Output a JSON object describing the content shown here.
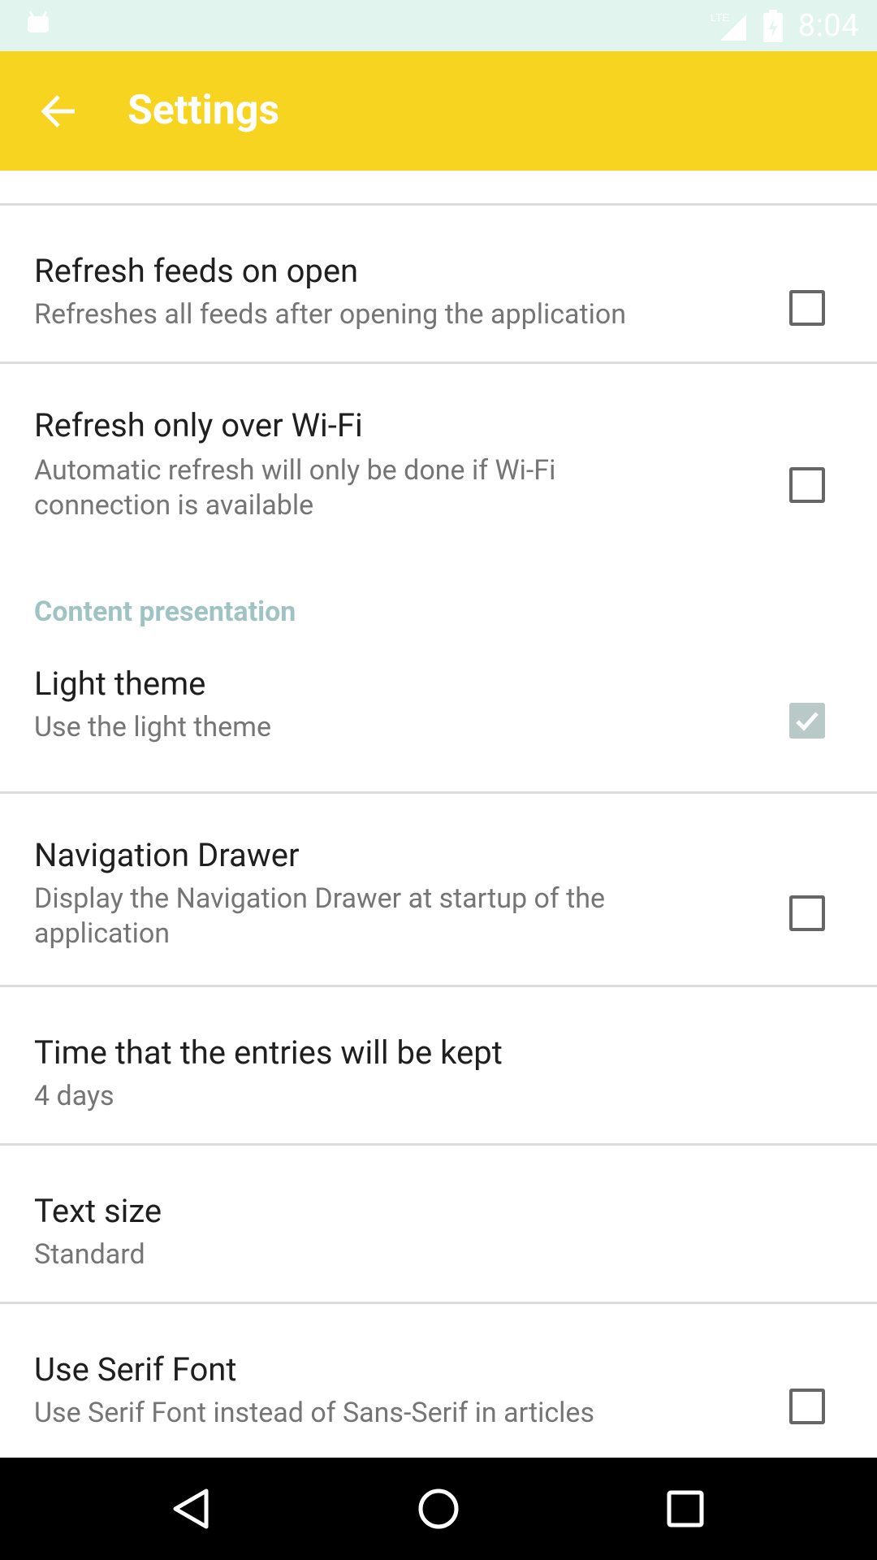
{
  "status_bar": {
    "time": "8:04",
    "network_label": "LTE",
    "icons": [
      "android-icon",
      "signal-icon",
      "battery-icon"
    ]
  },
  "app_bar": {
    "title": "Settings",
    "back_icon": "arrow-left-icon",
    "color": "#f6d420"
  },
  "preferences": [
    {
      "id": "refresh-on-open",
      "title": "Refresh feeds on open",
      "summary": "Refreshes all feeds after opening the application",
      "checkbox": true,
      "checked": false
    },
    {
      "id": "refresh-wifi",
      "title": "Refresh only over Wi-Fi",
      "summary": "Automatic refresh will only be done if Wi-Fi connection is available",
      "checkbox": true,
      "checked": false
    }
  ],
  "category": {
    "title": "Content presentation",
    "color": "#9fc3c3"
  },
  "presentation_preferences": [
    {
      "id": "light-theme",
      "title": "Light theme",
      "summary": "Use the light theme",
      "checkbox": true,
      "checked": true
    },
    {
      "id": "nav-drawer",
      "title": "Navigation Drawer",
      "summary": "Display the Navigation Drawer at startup of the application",
      "checkbox": true,
      "checked": false
    },
    {
      "id": "keep-time",
      "title": "Time that the entries will be kept",
      "summary": "4 days",
      "checkbox": false
    },
    {
      "id": "text-size",
      "title": "Text size",
      "summary": "Standard",
      "checkbox": false
    },
    {
      "id": "serif-font",
      "title": "Use Serif Font",
      "summary": "Use Serif Font instead of Sans-Serif in articles",
      "checkbox": true,
      "checked": false
    }
  ],
  "nav_bar": {
    "icons": [
      "back-triangle-icon",
      "home-circle-icon",
      "recents-square-icon"
    ]
  }
}
